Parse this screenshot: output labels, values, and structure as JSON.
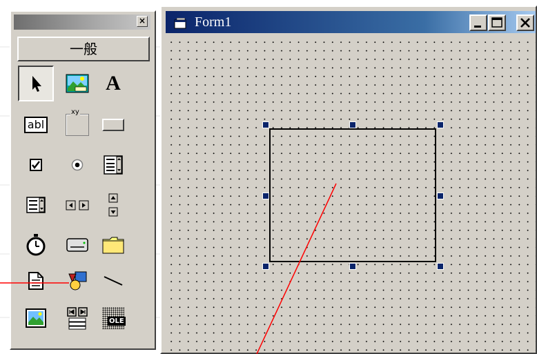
{
  "toolbox": {
    "close_glyph": "×",
    "tab_label": "一般",
    "tools": [
      {
        "name": "pointer-tool-icon"
      },
      {
        "name": "picturebox-tool-icon"
      },
      {
        "name": "label-tool-icon",
        "glyph": "A"
      },
      {
        "name": "textbox-tool-icon",
        "glyph": "abl"
      },
      {
        "name": "frame-tool-icon",
        "glyph": "xy"
      },
      {
        "name": "commandbutton-tool-icon"
      },
      {
        "name": "checkbox-tool-icon"
      },
      {
        "name": "optionbutton-tool-icon"
      },
      {
        "name": "combobox-tool-icon"
      },
      {
        "name": "listbox-tool-icon"
      },
      {
        "name": "hscrollbar-tool-icon"
      },
      {
        "name": "vscrollbar-tool-icon"
      },
      {
        "name": "timer-tool-icon"
      },
      {
        "name": "drivelistbox-tool-icon"
      },
      {
        "name": "dirlistbox-tool-icon"
      },
      {
        "name": "filelistbox-tool-icon"
      },
      {
        "name": "shape-tool-icon"
      },
      {
        "name": "line-tool-icon"
      },
      {
        "name": "image-tool-icon"
      },
      {
        "name": "data-tool-icon"
      },
      {
        "name": "ole-tool-icon",
        "glyph": "OLE"
      }
    ]
  },
  "form": {
    "title": "Form1",
    "minimize_glyph": "_",
    "maximize_glyph": "□",
    "close_glyph": "×"
  },
  "colors": {
    "window_face": "#d4d0c8",
    "title_active_start": "#0a246a",
    "title_active_end": "#a6caf0",
    "handle": "#0a246a",
    "annotation_line": "#ff0000"
  }
}
